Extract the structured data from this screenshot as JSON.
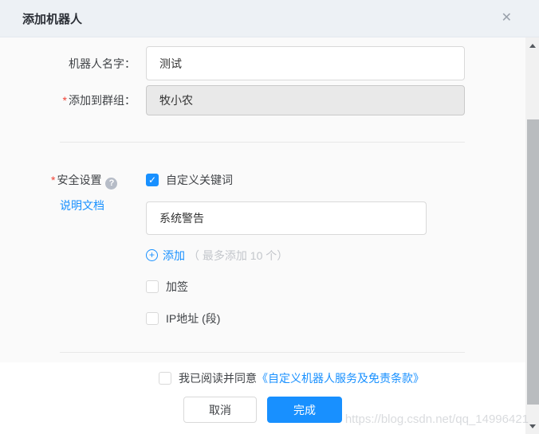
{
  "dialog": {
    "title": "添加机器人",
    "close_glyph": "✕"
  },
  "form": {
    "required_marker": "*",
    "name_field": {
      "label": "机器人名字：",
      "value": "测试"
    },
    "group_field": {
      "label": "添加到群组：",
      "value": "牧小农",
      "disabled": true
    },
    "security": {
      "label": "安全设置",
      "help_glyph": "?",
      "doc_link": "说明文档",
      "keyword_checkbox": {
        "label": "自定义关键词",
        "checked": true
      },
      "check_glyph": "✓",
      "keyword_value": "系统警告",
      "add_icon_glyph": "+",
      "add_link": "添加",
      "add_hint": "（ 最多添加 10 个）",
      "sign_checkbox": {
        "label": "加签",
        "checked": false
      },
      "ip_checkbox": {
        "label": "IP地址 (段)",
        "checked": false
      }
    }
  },
  "footer": {
    "agreement": {
      "checked": false,
      "text": "我已阅读并同意",
      "link": "《自定义机器人服务及免责条款》"
    },
    "cancel_label": "取消",
    "done_label": "完成"
  },
  "watermark": "https://blog.csdn.net/qq_14996421",
  "colors": {
    "accent": "#1890ff",
    "header_bg": "#edf1f5",
    "required": "#f04134",
    "disabled_bg": "#e9e9e9"
  }
}
